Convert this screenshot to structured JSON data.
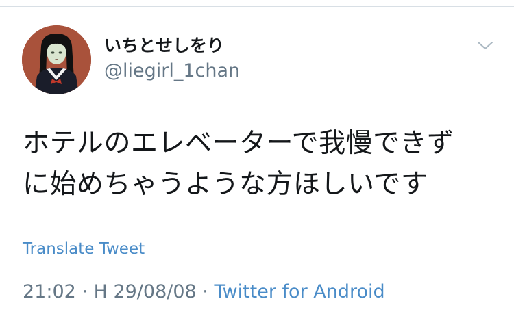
{
  "user": {
    "display_name": "いちとせしをり",
    "handle": "@liegirl_1chan"
  },
  "tweet": {
    "lines": [
      "ホテルのエレベーターで我慢できず",
      "に始めちゃうような方ほしいです"
    ],
    "translate_label": "Translate Tweet",
    "time": "21:02",
    "separator": " · ",
    "date": "H 29/08/08",
    "source": "Twitter for Android"
  },
  "icons": {
    "avatar": "avatar-illustration",
    "menu": "chevron-down-icon"
  },
  "colors": {
    "link": "#4a8cc8",
    "secondary_text": "#657786",
    "primary_text": "#14171a",
    "avatar_bg": "#a9523b"
  }
}
